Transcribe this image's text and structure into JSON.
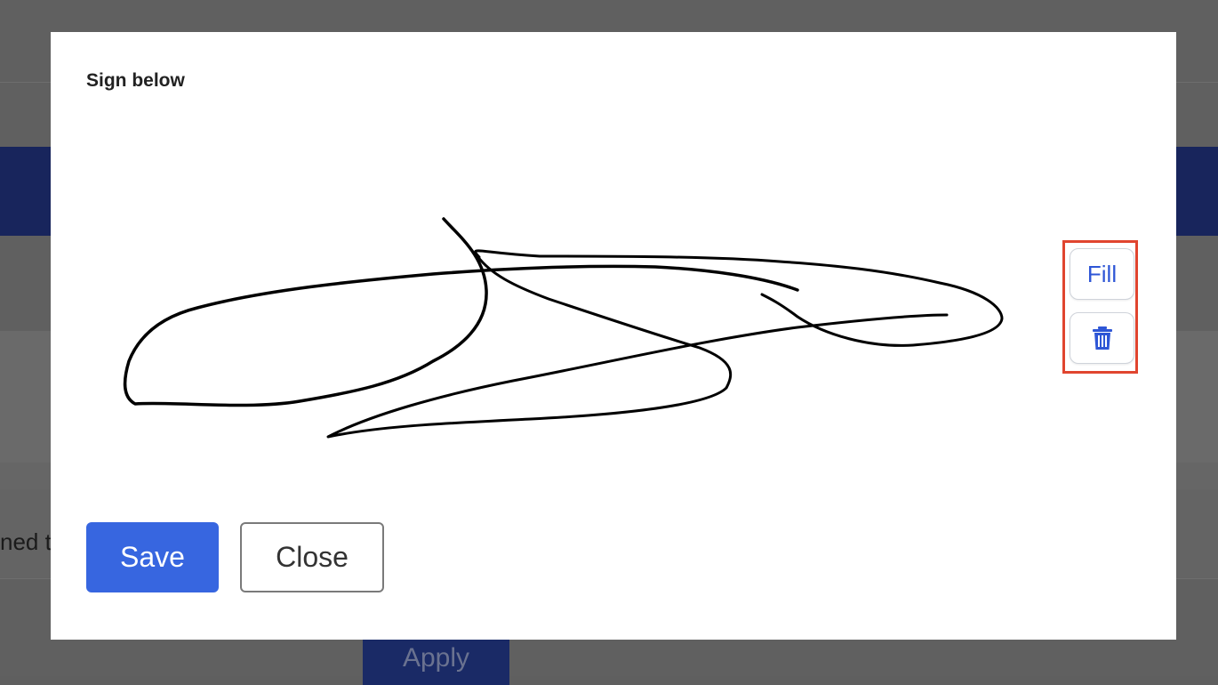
{
  "background": {
    "partial_text": "ned t",
    "apply_label": "Apply",
    "accent_color": "#1a2a66"
  },
  "modal": {
    "title": "Sign below",
    "tools": {
      "fill_label": "Fill",
      "clear_icon": "trash-icon",
      "highlight_color": "#e0452f"
    },
    "buttons": {
      "save_label": "Save",
      "close_label": "Close"
    },
    "colors": {
      "primary": "#3766e0",
      "tool_text": "#2e56d6"
    }
  }
}
